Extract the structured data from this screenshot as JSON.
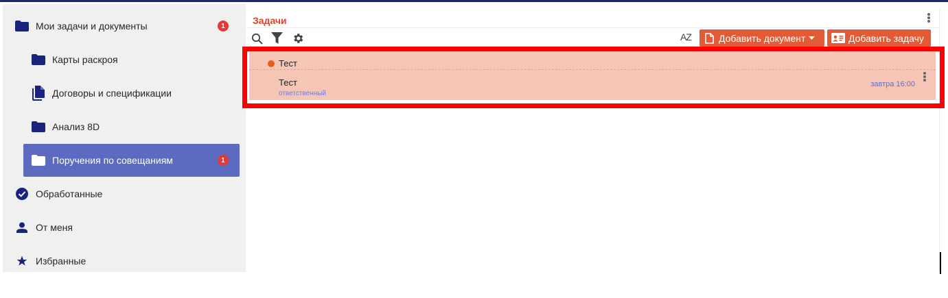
{
  "sidebar": {
    "items": [
      {
        "label": "Мои задачи и документы",
        "icon": "folder-icon",
        "badge": "1"
      },
      {
        "label": "Карты раскроя",
        "icon": "folder-icon"
      },
      {
        "label": "Договоры и спецификации",
        "icon": "documents-icon"
      },
      {
        "label": "Анализ 8D",
        "icon": "folder-icon"
      },
      {
        "label": "Поручения по совещаниям",
        "icon": "folder-icon",
        "badge": "1",
        "active": true
      },
      {
        "label": "Обработанные",
        "icon": "check-circle-icon"
      },
      {
        "label": "От меня",
        "icon": "person-icon"
      },
      {
        "label": "Избранные",
        "icon": "star-icon"
      }
    ]
  },
  "panel": {
    "title": "Задачи",
    "sort_label": "AZ",
    "add_document_label": "Добавить документ",
    "add_task_label": "Добавить задачу"
  },
  "tasks": {
    "group_title": "Тест",
    "items": [
      {
        "title": "Тест",
        "role": "ответственный",
        "due": "завтра 16:00"
      }
    ]
  },
  "colors": {
    "accent": "#e25b35",
    "title": "#d9452b",
    "active_nav": "#5c6bc0",
    "badge": "#e53935",
    "task_row": "#f5c6b6",
    "highlight": "#ff0000",
    "nav_icon": "#1a237e"
  }
}
